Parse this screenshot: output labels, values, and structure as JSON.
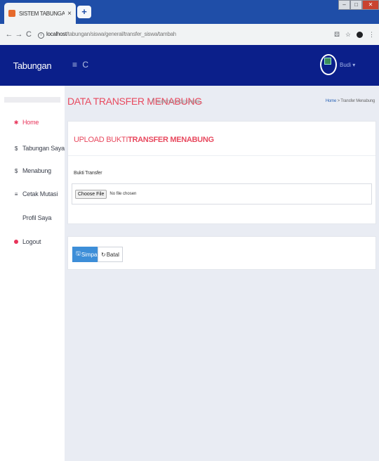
{
  "browser": {
    "tab_title": "SISTEM TABUNGAN",
    "tab_close": "×",
    "new_tab": "+",
    "url_host": "localhost",
    "url_path": "/tabungan/siswa/general/transfer_siswa/tambah"
  },
  "navbar": {
    "brand": "Tabungan",
    "menu_toggle": "≡ C",
    "user_name": "Budi ▾"
  },
  "sidebar": {
    "items": [
      {
        "icon": "✱",
        "label": "Home",
        "active": true
      },
      {
        "icon": "$",
        "label": "Tabungan Saya"
      },
      {
        "icon": "$",
        "label": "Menabung"
      },
      {
        "icon": "≡",
        "label": "Cetak Mutasi"
      },
      {
        "icon": "",
        "label": "Profil Saya"
      },
      {
        "icon": "●",
        "label": "Logout"
      }
    ]
  },
  "header": {
    "title": "DATA TRANSFER MENABUNG",
    "subtitle": "SUBTITLE GOES HERE...",
    "breadcrumb_home": "Home",
    "breadcrumb_sep": ">",
    "breadcrumb_current": "Transfer Menabung"
  },
  "upload_panel": {
    "title_prefix": "UPLOAD BUKTI",
    "title_bold": "TRANSFER MENABUNG",
    "field_label": "Bukti Transfer",
    "file_button": "Choose File",
    "file_status": "No file chosen"
  },
  "actions": {
    "save": "Simpan",
    "cancel": "Batal"
  },
  "colors": {
    "navbar": "#0b1f8a",
    "accent": "#e84a5f",
    "primary_button": "#3d8ed8"
  }
}
